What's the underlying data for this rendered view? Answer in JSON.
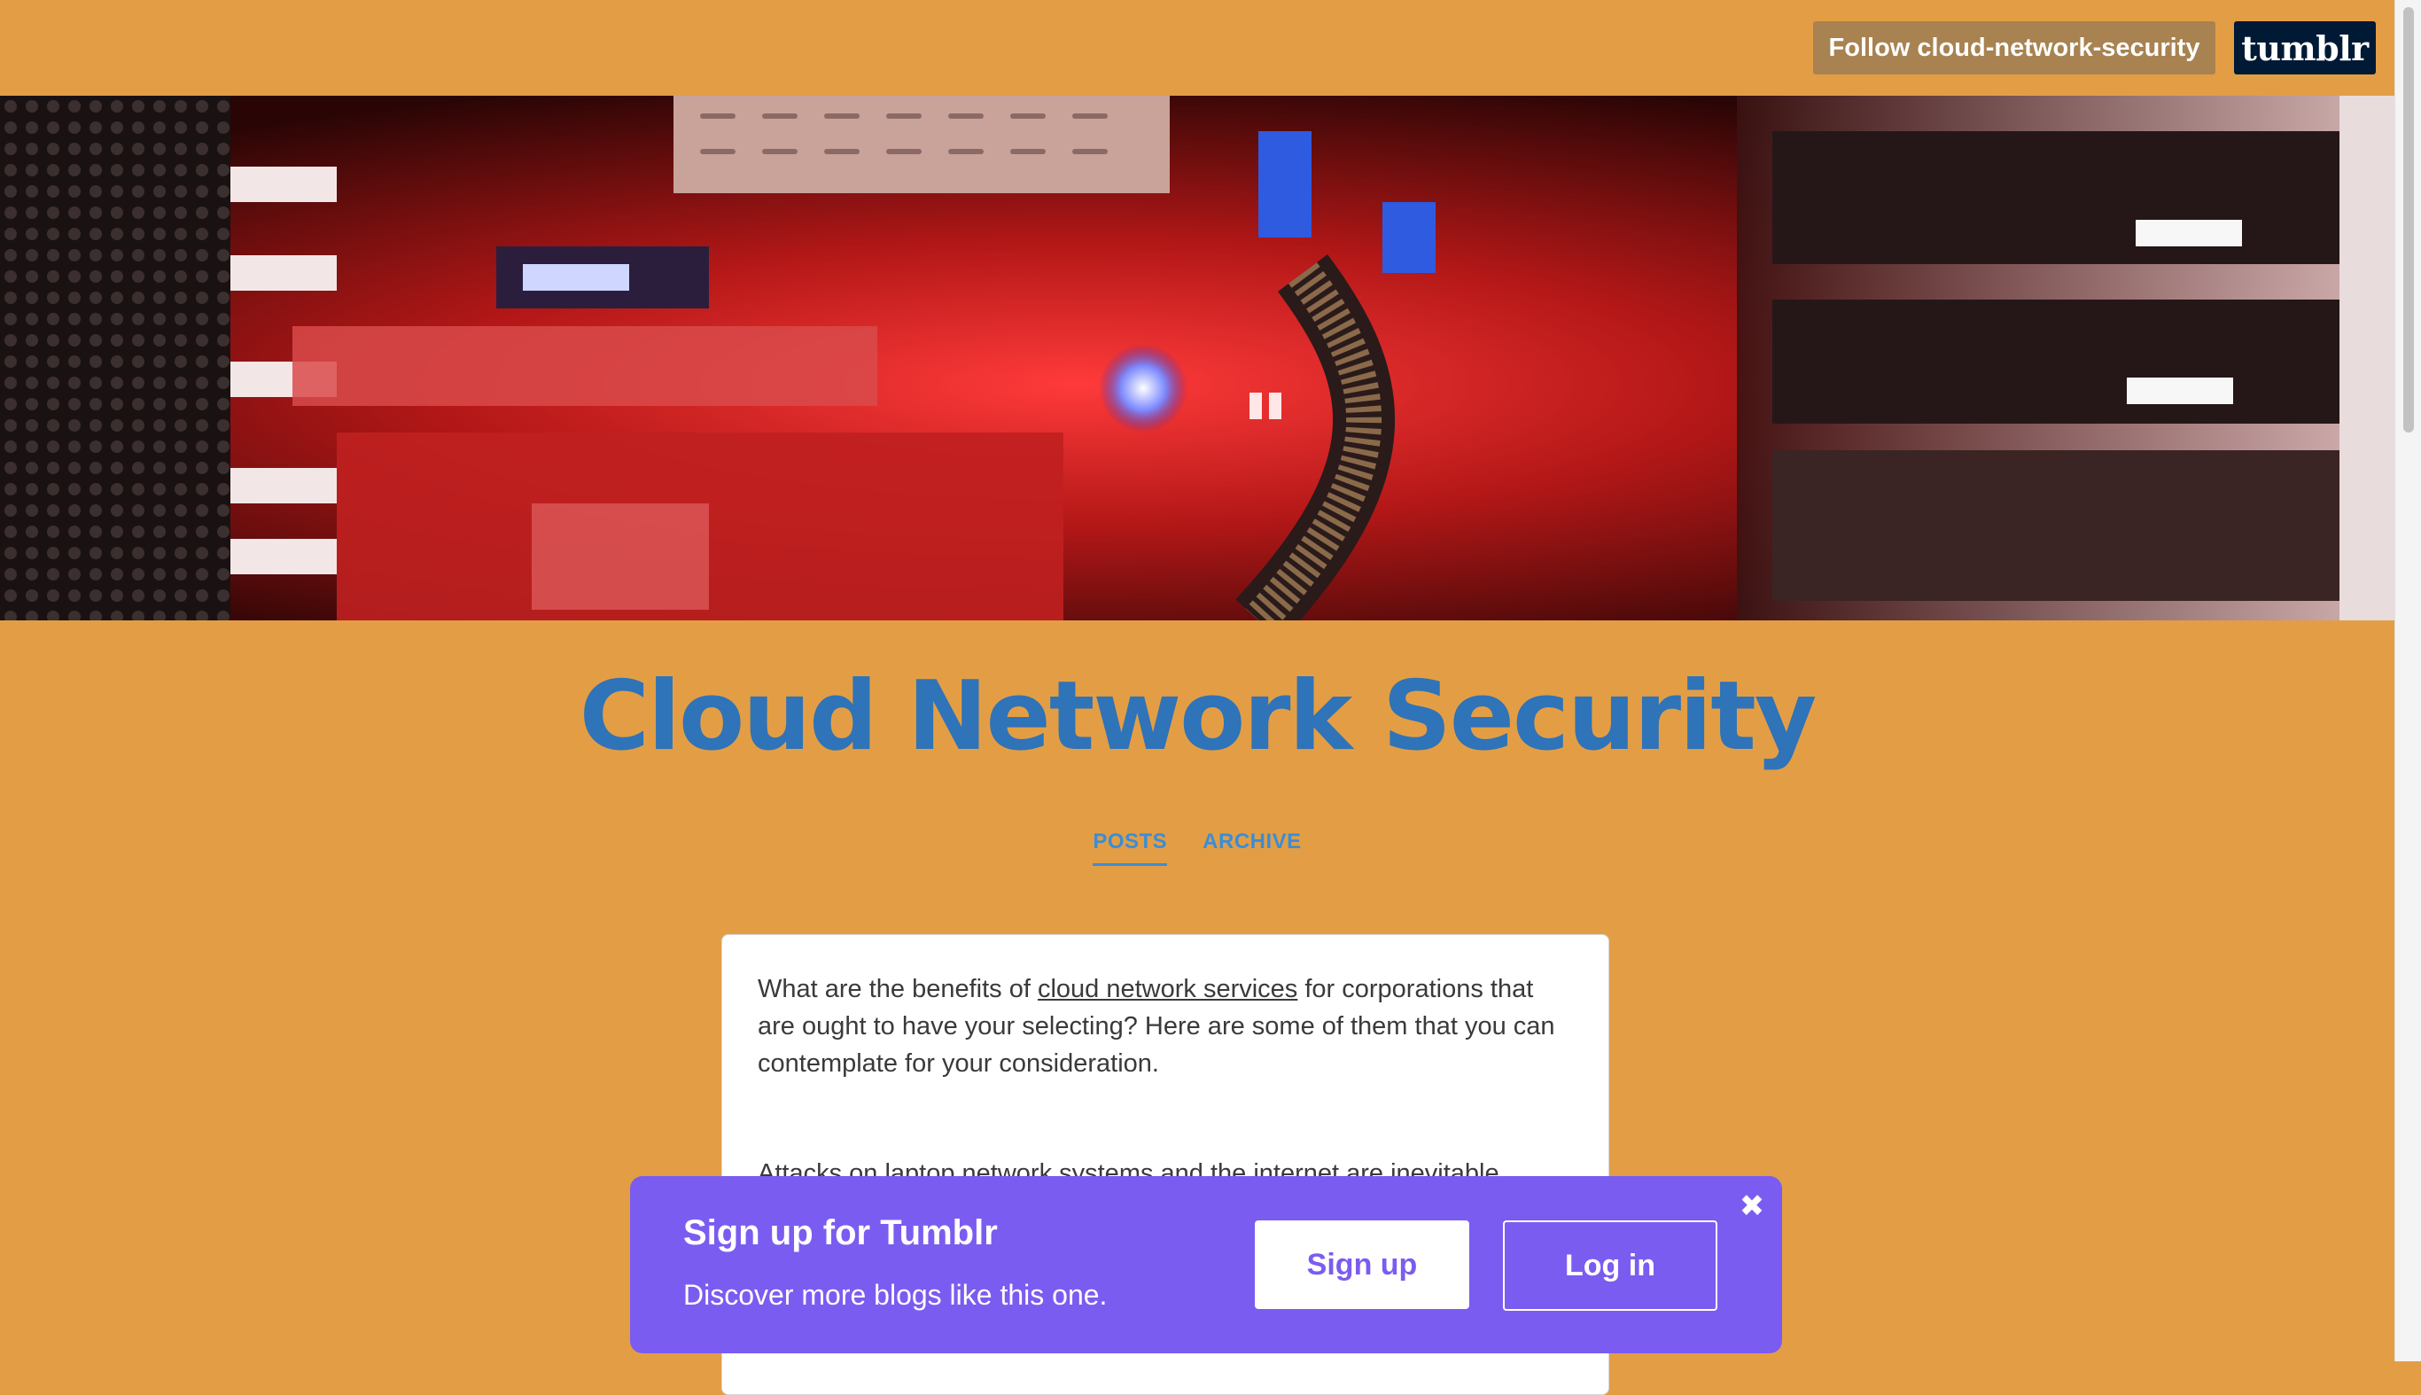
{
  "topbar": {
    "follow_label": "Follow cloud-network-security",
    "logo_text": "tumblr"
  },
  "blog": {
    "title": "Cloud Network Security"
  },
  "nav": {
    "items": [
      {
        "label": "POSTS",
        "active": true
      },
      {
        "label": "ARCHIVE",
        "active": false
      }
    ]
  },
  "post": {
    "p1_before": "What are the benefits of ",
    "p1_link": "cloud network services",
    "p1_after": " for corporations that are ought to have your selecting? Here are some of them that you can contemplate for your consideration.",
    "p2": "Attacks on laptop network systems and the internet are inevitable. ... Denial of Service to users was rejected as a result of the server was"
  },
  "signup_banner": {
    "title": "Sign up for Tumblr",
    "subtitle": "Discover more blogs like this one.",
    "signup_label": "Sign up",
    "login_label": "Log in",
    "close_icon": "close-icon"
  },
  "colors": {
    "background": "#E39E45",
    "title": "#2F73B8",
    "nav_link": "#3B8DD6",
    "follow_button": "#A88250",
    "tumblr_logo_bg": "#001935",
    "signup_banner": "#7B5CF0"
  }
}
